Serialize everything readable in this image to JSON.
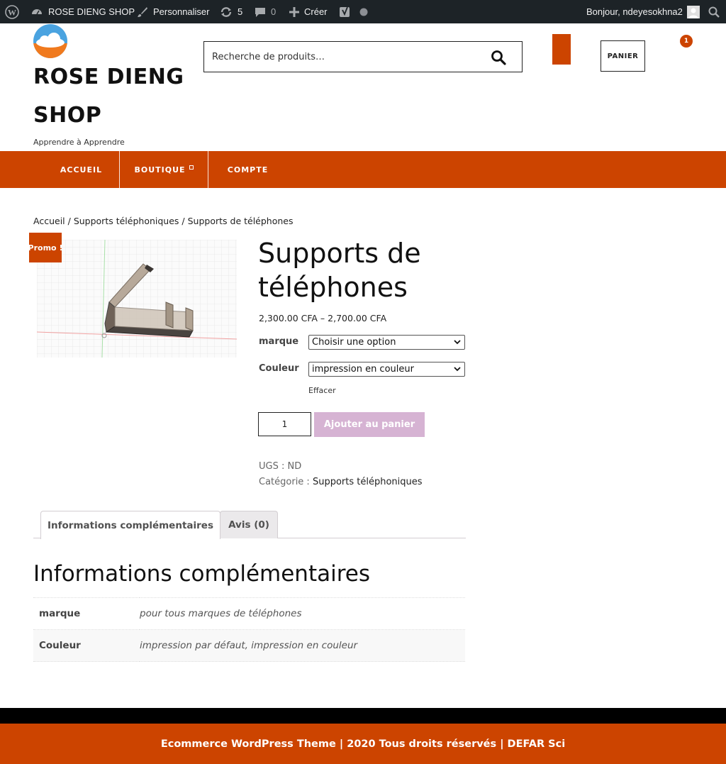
{
  "admin_bar": {
    "site_name": "ROSE DIENG SHOP",
    "customize_label": "Personnaliser",
    "updates_count": "5",
    "comments_count": "0",
    "new_label": "Créer",
    "greeting": "Bonjour, ndeyesokhna2"
  },
  "header": {
    "site_title": "ROSE DIENG SHOP",
    "tagline": "Apprendre à Apprendre",
    "search_placeholder": "Recherche de produits…",
    "cart_label": "PANIER",
    "cart_count": "1"
  },
  "nav": {
    "items": [
      {
        "label": "ACCUEIL"
      },
      {
        "label": "BOUTIQUE"
      },
      {
        "label": "COMPTE"
      }
    ]
  },
  "breadcrumb": {
    "home": "Accueil",
    "sep": " / ",
    "category": "Supports téléphoniques",
    "current": "Supports de téléphones"
  },
  "product": {
    "badge": "Promo !",
    "title": "Supports de téléphones",
    "price": "2,300.00 CFA – 2,700.00 CFA",
    "variations": [
      {
        "label": "marque",
        "selected": "Choisir une option"
      },
      {
        "label": "Couleur",
        "selected": "impression en couleur"
      }
    ],
    "clear_label": "Effacer",
    "quantity": "1",
    "add_to_cart": "Ajouter au panier",
    "sku_label": "UGS : ",
    "sku": "ND",
    "category_label": "Catégorie : ",
    "category": "Supports téléphoniques"
  },
  "tabs": [
    {
      "label": "Informations complémentaires"
    },
    {
      "label": "Avis (0)"
    }
  ],
  "additional_info": {
    "heading": "Informations complémentaires",
    "rows": [
      {
        "name": "marque",
        "value": "pour tous marques de téléphones"
      },
      {
        "name": "Couleur",
        "value": "impression par défaut, impression en couleur"
      }
    ]
  },
  "footer": {
    "text": "Ecommerce WordPress Theme | 2020 Tous droits réservés | DEFAR Sci"
  },
  "colors": {
    "accent": "#cc4400",
    "admin_bar": "#1d2327",
    "add_to_cart_disabled": "#d6b3d3"
  }
}
